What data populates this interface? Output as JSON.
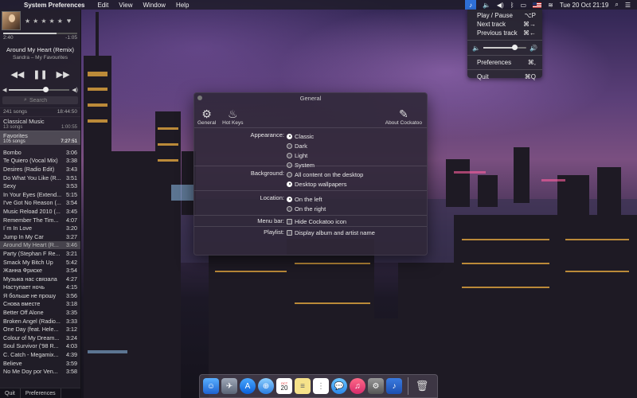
{
  "menubar": {
    "app_name": "System Preferences",
    "menus": [
      "Edit",
      "View",
      "Window",
      "Help"
    ],
    "clock": "Tue 20 Oct  21:19"
  },
  "status_menu": {
    "items": [
      {
        "label": "Play / Pause",
        "shortcut": "⌥P"
      },
      {
        "label": "Next track",
        "shortcut": "⌘→"
      },
      {
        "label": "Previous track",
        "shortcut": "⌘←"
      }
    ],
    "volume": 0.72,
    "preferences": {
      "label": "Preferences",
      "shortcut": "⌘,"
    },
    "quit": {
      "label": "Quit",
      "shortcut": "⌘Q"
    }
  },
  "player": {
    "time_elapsed": "2:40",
    "time_remaining": "-1:05",
    "progress": 0.72,
    "track_title": "Around My Heart (Remix)",
    "track_subtitle": "Sandra – My Favourites",
    "volume": 0.6,
    "search_placeholder": "Search",
    "playlists": [
      {
        "name": "241 songs",
        "duration": "18:44:50",
        "sub": "",
        "summary": true
      },
      {
        "name": "Classical Music",
        "duration": "1:00:55",
        "sub": "13 songs"
      },
      {
        "name": "Favorites",
        "duration": "7:27:51",
        "sub": "105 songs",
        "selected": true
      }
    ],
    "tracks": [
      {
        "name": "Bombo",
        "time": "3:06"
      },
      {
        "name": "Te Quiero (Vocal Mix)",
        "time": "3:38"
      },
      {
        "name": "Desires (Radio Edit)",
        "time": "3:43"
      },
      {
        "name": "Do What You Like (R...",
        "time": "3:51"
      },
      {
        "name": "Sexy",
        "time": "3:53"
      },
      {
        "name": "In Your Eyes (Extend...",
        "time": "5:15"
      },
      {
        "name": "I've Got No Reason (...",
        "time": "3:54"
      },
      {
        "name": "Music Reload 2010 (...",
        "time": "3:45"
      },
      {
        "name": "Remember The Tim...",
        "time": "4:07"
      },
      {
        "name": "I´m In Love",
        "time": "3:20"
      },
      {
        "name": "Jump In My Car",
        "time": "3:27"
      },
      {
        "name": "Around My Heart (R...",
        "time": "3:46",
        "current": true
      },
      {
        "name": "Party (Stephan F Re...",
        "time": "3:21"
      },
      {
        "name": "Smack My Bitch Up",
        "time": "5:42"
      },
      {
        "name": "Жанна Фриске",
        "time": "3:54"
      },
      {
        "name": "Музыка нас связала",
        "time": "4:27"
      },
      {
        "name": "Наступает ночь",
        "time": "4:15"
      },
      {
        "name": "Я больше не прошу",
        "time": "3:56"
      },
      {
        "name": "Снова вместе",
        "time": "3:18"
      },
      {
        "name": "Better Off Alone",
        "time": "3:35"
      },
      {
        "name": "Broken Angel (Radio...",
        "time": "3:33"
      },
      {
        "name": "One Day (feat. Hele...",
        "time": "3:12"
      },
      {
        "name": "Colour of My Dream...",
        "time": "3:24"
      },
      {
        "name": "Soul Survivor ('98 R...",
        "time": "4:03"
      },
      {
        "name": "C. Catch - Megamix...",
        "time": "4:39"
      },
      {
        "name": "Believe",
        "time": "3:59"
      },
      {
        "name": "No Me Doy por Ven...",
        "time": "3:58"
      }
    ],
    "quit_label": "Quit",
    "preferences_label": "Preferences"
  },
  "prefs": {
    "title": "General",
    "toolbar": {
      "general": "General",
      "hotkeys": "Hot Keys",
      "about": "About Cockatoo"
    },
    "appearance": {
      "label": "Appearance:",
      "options": [
        "Classic",
        "Dark",
        "Light",
        "System"
      ],
      "selected": 0
    },
    "background": {
      "label": "Background:",
      "options": [
        "All content on the desktop",
        "Desktop wallpapers"
      ],
      "selected": 1
    },
    "location": {
      "label": "Location:",
      "options": [
        "On the left",
        "On the right"
      ],
      "selected": 0
    },
    "menubar": {
      "label": "Menu bar:",
      "option": "Hide Cockatoo icon"
    },
    "playlist": {
      "label": "Playlist:",
      "option": "Display album and artist name"
    }
  },
  "dock": {
    "calendar_month": "OCT",
    "calendar_day": "20"
  },
  "colors": {
    "accent": "#2e6fd6",
    "panel_bg": "#221e28",
    "window_bg": "#302838"
  }
}
